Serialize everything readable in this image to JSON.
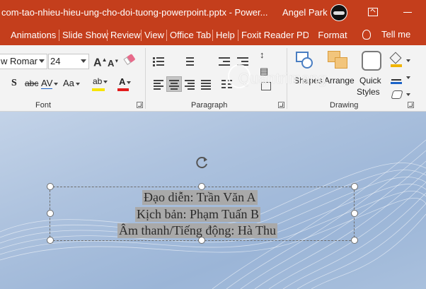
{
  "window": {
    "title": "com-tao-nhieu-hieu-ung-cho-doi-tuong-powerpoint.pptx  -  Power...",
    "user": "Angel Park"
  },
  "tabs": [
    "Animations",
    "Slide Show",
    "Review",
    "View",
    "Office Tab",
    "Help",
    "Foxit Reader PDF"
  ],
  "active_tab": "Format",
  "tell_me": "Tell me",
  "font": {
    "name": "w Romar",
    "size": "24",
    "group_label": "Font",
    "char_spacing_label": "AV",
    "change_case_label": "Aa",
    "strike_label": "abc",
    "shadow_label": "S",
    "highlight_label": "ab",
    "color_label": "A",
    "grow_label": "A",
    "shrink_label": "A"
  },
  "paragraph": {
    "group_label": "Paragraph"
  },
  "drawing": {
    "group_label": "Drawing",
    "shapes_label": "Shapes",
    "arrange_label": "Arrange",
    "quick_styles_label_1": "Quick",
    "quick_styles_label_2": "Styles"
  },
  "watermark": "Quantrimang",
  "slide": {
    "lines": [
      "Đạo diễn: Trần Văn A",
      "Kịch bản: Phạm Tuấn B",
      "Âm thanh/Tiếng động: Hà Thu"
    ]
  },
  "colors": {
    "title_bar": "#c43e1c",
    "ribbon_bg": "#f3f3f3",
    "text_highlight": "#a9a9a9",
    "highlight_bar": "#f7e400",
    "font_color_bar": "#e21c1c"
  },
  "icons": [
    "ribbon-display-options-icon",
    "minimize-icon",
    "lightbulb-icon",
    "rotate-handle-icon"
  ]
}
